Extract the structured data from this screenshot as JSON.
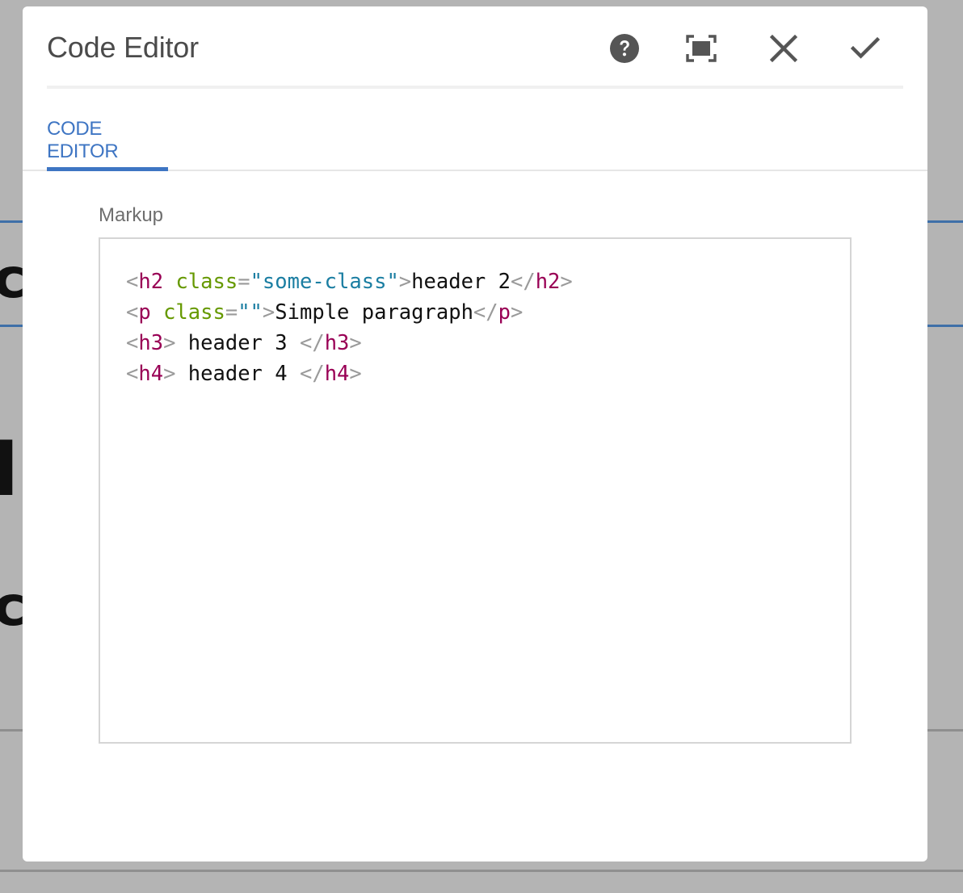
{
  "dialog": {
    "title": "Code Editor",
    "actions": [
      {
        "name": "help-icon",
        "label": "Help"
      },
      {
        "name": "fullscreen-icon",
        "label": "Fullscreen"
      },
      {
        "name": "close-icon",
        "label": "Cancel"
      },
      {
        "name": "checkmark-icon",
        "label": "Done"
      }
    ]
  },
  "tabs": [
    {
      "label": "CODE EDITOR",
      "active": true
    }
  ],
  "markup_field": {
    "label": "Markup",
    "lines": [
      [
        {
          "t": "b",
          "s": "<"
        },
        {
          "t": "t",
          "s": "h2"
        },
        {
          "t": "x",
          "s": " "
        },
        {
          "t": "a",
          "s": "class"
        },
        {
          "t": "b",
          "s": "="
        },
        {
          "t": "v",
          "s": "\"some-class\""
        },
        {
          "t": "b",
          "s": ">"
        },
        {
          "t": "x",
          "s": "header 2"
        },
        {
          "t": "b",
          "s": "</"
        },
        {
          "t": "t",
          "s": "h2"
        },
        {
          "t": "b",
          "s": ">"
        }
      ],
      [
        {
          "t": "b",
          "s": "<"
        },
        {
          "t": "t",
          "s": "p"
        },
        {
          "t": "x",
          "s": " "
        },
        {
          "t": "a",
          "s": "class"
        },
        {
          "t": "b",
          "s": "="
        },
        {
          "t": "v",
          "s": "\"\""
        },
        {
          "t": "b",
          "s": ">"
        },
        {
          "t": "x",
          "s": "Simple paragraph"
        },
        {
          "t": "b",
          "s": "</"
        },
        {
          "t": "t",
          "s": "p"
        },
        {
          "t": "b",
          "s": ">"
        }
      ],
      [
        {
          "t": "b",
          "s": "<"
        },
        {
          "t": "t",
          "s": "h3"
        },
        {
          "t": "b",
          "s": ">"
        },
        {
          "t": "x",
          "s": " header 3 "
        },
        {
          "t": "b",
          "s": "</"
        },
        {
          "t": "t",
          "s": "h3"
        },
        {
          "t": "b",
          "s": ">"
        }
      ],
      [
        {
          "t": "b",
          "s": "<"
        },
        {
          "t": "t",
          "s": "h4"
        },
        {
          "t": "b",
          "s": ">"
        },
        {
          "t": "x",
          "s": " header 4 "
        },
        {
          "t": "b",
          "s": "</"
        },
        {
          "t": "t",
          "s": "h4"
        },
        {
          "t": "b",
          "s": ">"
        }
      ]
    ]
  },
  "colors": {
    "accent": "#3e75c3",
    "tag": "#990055",
    "attribute": "#669900",
    "string": "#1b7ea2",
    "bracket": "#9a9a9a",
    "text": "#111111"
  }
}
